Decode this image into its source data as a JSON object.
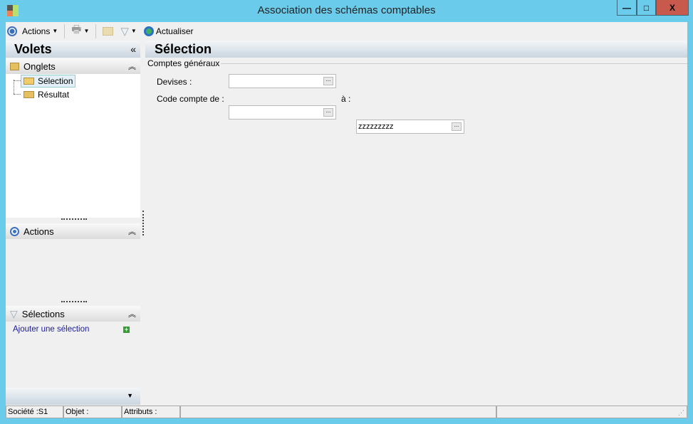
{
  "window": {
    "title": "Association des schémas comptables",
    "minimize": "—",
    "maximize": "□",
    "close": "X"
  },
  "toolbar": {
    "actions": "Actions",
    "refresh": "Actualiser"
  },
  "left": {
    "title": "Volets",
    "collapse": "«",
    "onglets": {
      "title": "Onglets",
      "items": [
        "Sélection",
        "Résultat"
      ]
    },
    "actions": {
      "title": "Actions"
    },
    "selections": {
      "title": "Sélections",
      "add": "Ajouter une sélection"
    }
  },
  "main": {
    "title": "Sélection",
    "group": "Comptes généraux",
    "devises_label": "Devises :",
    "devises_value": "",
    "code_label": "Code compte de :",
    "code_from": "",
    "a_label": "à :",
    "code_to": "zzzzzzzzz"
  },
  "status": {
    "societe": "Société :S1",
    "objet": "Objet :",
    "attributs": "Attributs :"
  }
}
